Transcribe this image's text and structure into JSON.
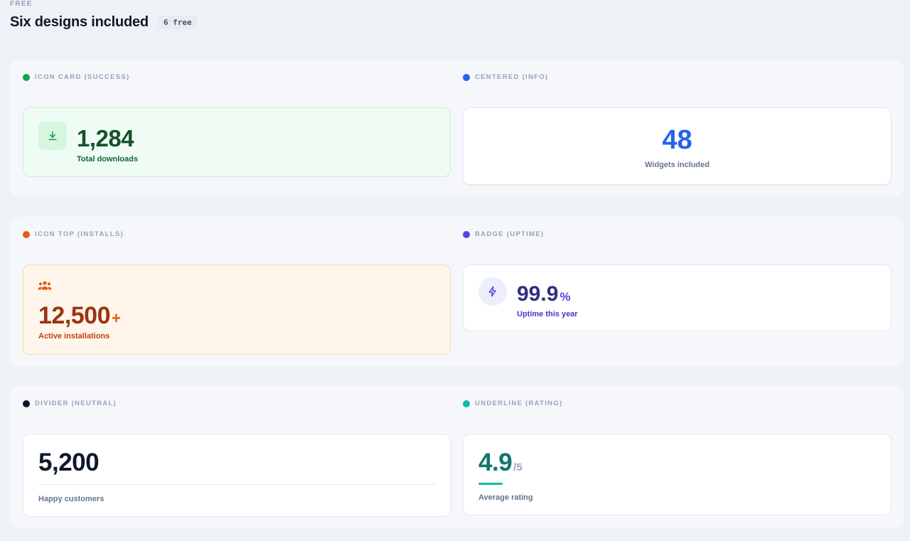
{
  "header": {
    "eyebrow": "FREE",
    "title": "Six designs included",
    "count": "6 free"
  },
  "widgets": {
    "icon_card": {
      "label": "ICON CARD (SUCCESS)",
      "dot_color": "#16a34a",
      "icon": "download-icon",
      "value": "1,284",
      "caption": "Total downloads"
    },
    "centered": {
      "label": "CENTERED (INFO)",
      "dot_color": "#2563eb",
      "value": "48",
      "caption": "Widgets included"
    },
    "icon_top": {
      "label": "ICON TOP (INSTALLS)",
      "dot_color": "#ea580c",
      "icon": "users-icon",
      "value": "12,500",
      "suffix": "+",
      "caption": "Active installations"
    },
    "badge": {
      "label": "BADGE (UPTIME)",
      "dot_color": "#4f46e5",
      "icon": "lightning-icon",
      "value": "99.9",
      "suffix": "%",
      "caption": "Uptime this year"
    },
    "divider": {
      "label": "DIVIDER (NEUTRAL)",
      "dot_color": "#0f172a",
      "value": "5,200",
      "caption": "Happy customers"
    },
    "underline": {
      "label": "UNDERLINE (RATING)",
      "dot_color": "#14b8a6",
      "value": "4.9",
      "suffix": "/5",
      "caption": "Average rating"
    }
  }
}
